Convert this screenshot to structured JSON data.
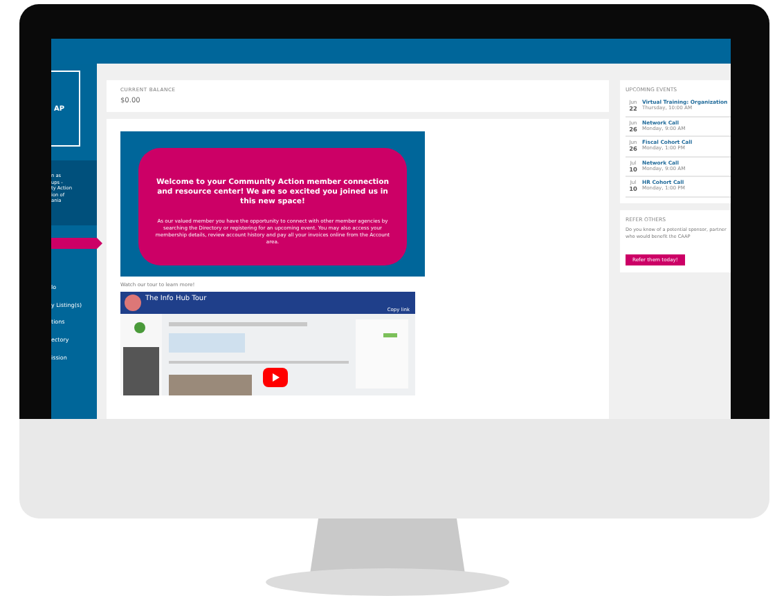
{
  "sidebar": {
    "logo_text": "AP",
    "blurb_lines": [
      "n as",
      "ups -",
      "ty Action",
      "ion of",
      "ania"
    ],
    "nav": [
      {
        "selected": true
      },
      {
        "label": "lo",
        "selected": false
      },
      {
        "label": "y Listing(s)",
        "selected": false
      },
      {
        "label": "tions",
        "selected": false
      },
      {
        "label": "ectory",
        "selected": false
      },
      {
        "label": "ission",
        "selected": false
      }
    ]
  },
  "balance": {
    "label": "CURRENT BALANCE",
    "value": "$0.00"
  },
  "welcome": {
    "heading": "Welcome to your Community Action member connection and resource center! We are so excited you joined us in this new space!",
    "body": "As our valued member you have the opportunity to connect with other member agencies by searching the Directory or registering for an upcoming event. You may also access your membership details, review account history and pay all your invoices online from the Account area.",
    "tour_caption": "Watch our tour to learn more!",
    "video": {
      "title": "The Info Hub Tour",
      "action": "Copy link"
    }
  },
  "upcoming_events": {
    "title": "UPCOMING EVENTS",
    "events": [
      {
        "month": "Jun",
        "day": "22",
        "title": "Virtual Training: Organization",
        "time": "Thursday, 10:00 AM"
      },
      {
        "month": "Jun",
        "day": "26",
        "title": "Network Call",
        "time": "Monday, 9:00 AM"
      },
      {
        "month": "Jun",
        "day": "26",
        "title": "Fiscal Cohort Call",
        "time": "Monday, 1:00 PM"
      },
      {
        "month": "Jul",
        "day": "10",
        "title": "Network Call",
        "time": "Monday, 9:00 AM"
      },
      {
        "month": "Jul",
        "day": "10",
        "title": "HR Cohort Call",
        "time": "Monday, 1:00 PM"
      }
    ]
  },
  "refer_others": {
    "title": "REFER OTHERS",
    "text": "Do you know of a potential sponsor, partner who would benefit the CAAP",
    "button": "Refer them today!"
  }
}
